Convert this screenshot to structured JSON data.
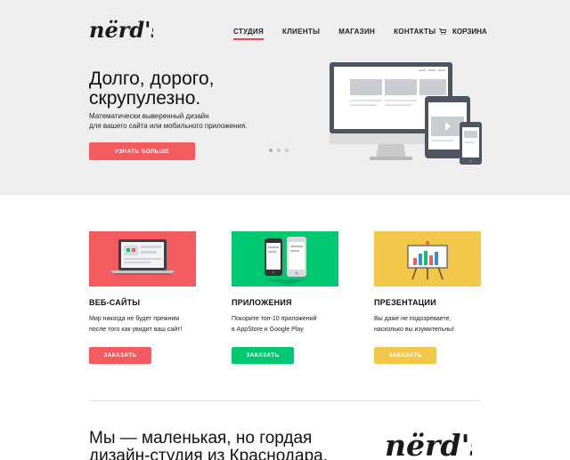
{
  "brand": {
    "logo_text": "nërd's"
  },
  "nav": {
    "items": [
      {
        "label": "СТУДИЯ",
        "active": true
      },
      {
        "label": "КЛИЕНТЫ",
        "active": false
      },
      {
        "label": "МАГАЗИН",
        "active": false
      },
      {
        "label": "КОНТАКТЫ",
        "active": false
      }
    ],
    "cart_label": "КОРЗИНА"
  },
  "hero": {
    "title_line1": "Долго, дорого,",
    "title_line2": "скрупулезно.",
    "text_line1": "Математически выверенный дизайн",
    "text_line2": "для вашего сайта или мобильного приложения.",
    "button": "УЗНАТЬ БОЛЬШЕ",
    "slides": 3,
    "active_slide": 1
  },
  "features": [
    {
      "title": "ВЕБ-САЙТЫ",
      "text_line1": "Мир никогда не будет прежним",
      "text_line2": "после того как увидит ваш сайт!",
      "button": "ЗАКАЗАТЬ",
      "color": "#f35b5f"
    },
    {
      "title": "ПРИЛОЖЕНИЯ",
      "text_line1": "Покорите топ-10 приложений",
      "text_line2": "в AppStore и Google Play",
      "button": "ЗАКАЗАТЬ",
      "color": "#00c870"
    },
    {
      "title": "ПРЕЗЕНТАЦИИ",
      "text_line1": "Вы даже не подозреваете,",
      "text_line2": "насколько вы изумительны!",
      "button": "ЗАКАЗАТЬ",
      "color": "#f3c84a"
    }
  ],
  "about": {
    "title_line1": "Мы — маленькая, но гордая",
    "title_line2": "дизайн-студия из Краснодара."
  },
  "colors": {
    "accent": "#f0454d",
    "hero_bg": "#eeeeee",
    "device_dark": "#4e5560"
  },
  "icons": {
    "cart": "cart-icon"
  }
}
